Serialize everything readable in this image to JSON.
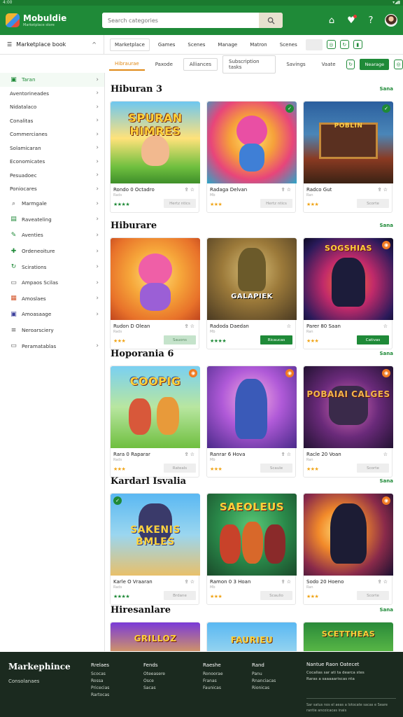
{
  "status": {
    "left": "4:00",
    "right": "▾◢▮"
  },
  "app": {
    "name": "Mobuldie",
    "subtitle": "Marketplace store"
  },
  "search": {
    "placeholder": "Search categories"
  },
  "header_icons": [
    "home-icon",
    "notification-icon",
    "help-icon",
    "profile-avatar"
  ],
  "category_bar": {
    "label": "Marketplace book"
  },
  "top_nav": [
    "Marketplace",
    "Games",
    "Scenes",
    "Manage",
    "Matron",
    "Scenes"
  ],
  "tabs": [
    "Hibraurae",
    "Paxode",
    "Alliances",
    "Subscription tasks",
    "Savings",
    "Vaate",
    "Nearage"
  ],
  "sidebar": [
    {
      "label": "Taran",
      "icon": "store-icon",
      "active": true
    },
    {
      "label": "Aventorineades",
      "icon": ""
    },
    {
      "label": "Nidatalaco",
      "icon": ""
    },
    {
      "label": "Conalitas",
      "icon": ""
    },
    {
      "label": "Commercianes",
      "icon": ""
    },
    {
      "label": "Solamicaran",
      "icon": ""
    },
    {
      "label": "Economicates",
      "icon": ""
    },
    {
      "label": "Pesuadoec",
      "icon": ""
    },
    {
      "label": "Poniocares",
      "icon": ""
    },
    {
      "label": "Marmgale",
      "icon": "search-icon"
    },
    {
      "label": "Raveateling",
      "icon": "chart-icon"
    },
    {
      "label": "Aventies",
      "icon": "pen-icon"
    },
    {
      "label": "Ordeneoiture",
      "icon": "puzzle-icon"
    },
    {
      "label": "Scirations",
      "icon": "refresh-icon"
    },
    {
      "label": "Ampaos Scilas",
      "icon": "document-icon"
    },
    {
      "label": "Amoslaes",
      "icon": "calendar-icon"
    },
    {
      "label": "Amoasaage",
      "icon": "image-icon"
    },
    {
      "label": "Neroarsciery",
      "icon": "list-icon"
    },
    {
      "label": "Peramatablas",
      "icon": "tag-icon"
    }
  ],
  "sections": [
    {
      "title": "Hiburan 3",
      "more": "Sana",
      "cards": [
        {
          "art_text": "SPURAN HIMRES",
          "title": "Rondo 0 Octadro",
          "meta": "Rads",
          "stars": "★★★★",
          "price": "Hertz ntics",
          "badge": ""
        },
        {
          "art_text": "",
          "title": "Radaga Delvan",
          "meta": "Mb",
          "stars": "★★★",
          "price": "Hertz ntics",
          "badge": "✓"
        },
        {
          "art_text": "POBLIN",
          "title": "Radco Gut",
          "meta": "Ran",
          "stars": "★★★",
          "price": "Scorte",
          "badge": "✓"
        }
      ]
    },
    {
      "title": "Hiburare",
      "more": "Sana",
      "cards": [
        {
          "art_text": "",
          "title": "Rudon D Olean",
          "meta": "Rads",
          "stars": "★★★",
          "price": "Sauons",
          "badge": ""
        },
        {
          "art_text": "GALAPIEK",
          "title": "Radoda Daedan",
          "meta": "Mb",
          "stars": "★★★★",
          "price": "Ricaucas",
          "badge": ""
        },
        {
          "art_text": "SOGSHIAS",
          "title": "Parer 80 Saan",
          "meta": "Ran",
          "stars": "★★★",
          "price": "Cativas",
          "badge": "◉"
        }
      ]
    },
    {
      "title": "Hoporania 6",
      "more": "Sana",
      "cards": [
        {
          "art_text": "COOPIG",
          "title": "Rara 0 Raparar",
          "meta": "Rads",
          "stars": "★★★",
          "price": "Rateals",
          "badge": "◉"
        },
        {
          "art_text": "",
          "title": "Ranrar 6 Hova",
          "meta": "Mb",
          "stars": "★★★",
          "price": "Scaule",
          "badge": "◉"
        },
        {
          "art_text": "POBAIAI CALGES",
          "title": "Racle 20 Voan",
          "meta": "Ran",
          "stars": "★★★",
          "price": "Scorte",
          "badge": "◉"
        }
      ]
    },
    {
      "title": "Kardarl Isvalia",
      "more": "Sana",
      "cards": [
        {
          "art_text": "SAKENIS BMLES",
          "title": "Karle O Vraaran",
          "meta": "Rads",
          "stars": "★★★★",
          "price": "Brdane",
          "badge": "✓"
        },
        {
          "art_text": "SAEOLEUS",
          "title": "Ramon 0 3 Hoan",
          "meta": "Mb",
          "stars": "★★★",
          "price": "Scaulio",
          "badge": ""
        },
        {
          "art_text": "",
          "title": "Sodo 20 Hoeno",
          "meta": "Ran",
          "stars": "★★★",
          "price": "Scorte",
          "badge": "◉"
        }
      ]
    },
    {
      "title": "Hiresanlare",
      "more": "Sana",
      "cards": [
        {
          "art_text": "GRILLOZ",
          "title": "",
          "meta": "",
          "stars": "",
          "price": "",
          "badge": ""
        },
        {
          "art_text": "FAURIEU",
          "title": "",
          "meta": "",
          "stars": "",
          "price": "",
          "badge": ""
        },
        {
          "art_text": "SCETTHEAS",
          "title": "",
          "meta": "",
          "stars": "",
          "price": "",
          "badge": ""
        }
      ]
    }
  ],
  "footer": {
    "brand": "Markephince",
    "tagline": "Consolanaes",
    "columns": [
      {
        "heading": "Rrelaes",
        "links": [
          "Scocas",
          "Rossa",
          "Pricecias",
          "Rartocas"
        ]
      },
      {
        "heading": "Fends",
        "links": [
          "Oteeasere",
          "Osce",
          "Sacas"
        ]
      },
      {
        "heading": "Raeshe",
        "links": [
          "Ronoorae",
          "Franas",
          "Faunicas"
        ]
      },
      {
        "heading": "Rand",
        "links": [
          "Panu",
          "Rnanciacas",
          "Rionicas"
        ]
      }
    ],
    "right_heading": "Nantue Raon Oatecet",
    "right_lines": [
      "Cocalias sar ati ta dearca stes",
      "Raras a saaaaariscas nta"
    ],
    "copyright": "Sar satus nos el aeas a lotocate sacas e Seare rantie ancoicacas inais"
  },
  "colors": {
    "brand_green": "#1f8a38",
    "accent_orange": "#e08a17",
    "star_gold": "#f0a417",
    "footer_bg": "#1b2a1f"
  }
}
